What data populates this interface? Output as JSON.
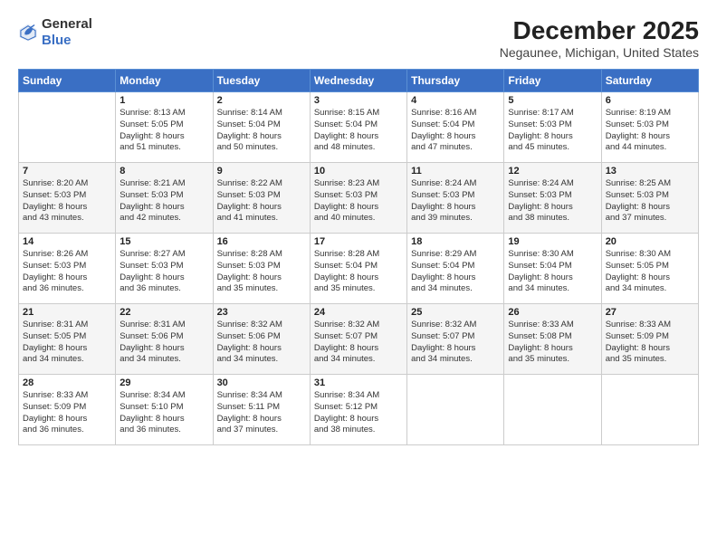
{
  "logo": {
    "general": "General",
    "blue": "Blue"
  },
  "title": "December 2025",
  "subtitle": "Negaunee, Michigan, United States",
  "days_header": [
    "Sunday",
    "Monday",
    "Tuesday",
    "Wednesday",
    "Thursday",
    "Friday",
    "Saturday"
  ],
  "weeks": [
    [
      {
        "day": "",
        "lines": []
      },
      {
        "day": "1",
        "lines": [
          "Sunrise: 8:13 AM",
          "Sunset: 5:05 PM",
          "Daylight: 8 hours",
          "and 51 minutes."
        ]
      },
      {
        "day": "2",
        "lines": [
          "Sunrise: 8:14 AM",
          "Sunset: 5:04 PM",
          "Daylight: 8 hours",
          "and 50 minutes."
        ]
      },
      {
        "day": "3",
        "lines": [
          "Sunrise: 8:15 AM",
          "Sunset: 5:04 PM",
          "Daylight: 8 hours",
          "and 48 minutes."
        ]
      },
      {
        "day": "4",
        "lines": [
          "Sunrise: 8:16 AM",
          "Sunset: 5:04 PM",
          "Daylight: 8 hours",
          "and 47 minutes."
        ]
      },
      {
        "day": "5",
        "lines": [
          "Sunrise: 8:17 AM",
          "Sunset: 5:03 PM",
          "Daylight: 8 hours",
          "and 45 minutes."
        ]
      },
      {
        "day": "6",
        "lines": [
          "Sunrise: 8:19 AM",
          "Sunset: 5:03 PM",
          "Daylight: 8 hours",
          "and 44 minutes."
        ]
      }
    ],
    [
      {
        "day": "7",
        "lines": [
          "Sunrise: 8:20 AM",
          "Sunset: 5:03 PM",
          "Daylight: 8 hours",
          "and 43 minutes."
        ]
      },
      {
        "day": "8",
        "lines": [
          "Sunrise: 8:21 AM",
          "Sunset: 5:03 PM",
          "Daylight: 8 hours",
          "and 42 minutes."
        ]
      },
      {
        "day": "9",
        "lines": [
          "Sunrise: 8:22 AM",
          "Sunset: 5:03 PM",
          "Daylight: 8 hours",
          "and 41 minutes."
        ]
      },
      {
        "day": "10",
        "lines": [
          "Sunrise: 8:23 AM",
          "Sunset: 5:03 PM",
          "Daylight: 8 hours",
          "and 40 minutes."
        ]
      },
      {
        "day": "11",
        "lines": [
          "Sunrise: 8:24 AM",
          "Sunset: 5:03 PM",
          "Daylight: 8 hours",
          "and 39 minutes."
        ]
      },
      {
        "day": "12",
        "lines": [
          "Sunrise: 8:24 AM",
          "Sunset: 5:03 PM",
          "Daylight: 8 hours",
          "and 38 minutes."
        ]
      },
      {
        "day": "13",
        "lines": [
          "Sunrise: 8:25 AM",
          "Sunset: 5:03 PM",
          "Daylight: 8 hours",
          "and 37 minutes."
        ]
      }
    ],
    [
      {
        "day": "14",
        "lines": [
          "Sunrise: 8:26 AM",
          "Sunset: 5:03 PM",
          "Daylight: 8 hours",
          "and 36 minutes."
        ]
      },
      {
        "day": "15",
        "lines": [
          "Sunrise: 8:27 AM",
          "Sunset: 5:03 PM",
          "Daylight: 8 hours",
          "and 36 minutes."
        ]
      },
      {
        "day": "16",
        "lines": [
          "Sunrise: 8:28 AM",
          "Sunset: 5:03 PM",
          "Daylight: 8 hours",
          "and 35 minutes."
        ]
      },
      {
        "day": "17",
        "lines": [
          "Sunrise: 8:28 AM",
          "Sunset: 5:04 PM",
          "Daylight: 8 hours",
          "and 35 minutes."
        ]
      },
      {
        "day": "18",
        "lines": [
          "Sunrise: 8:29 AM",
          "Sunset: 5:04 PM",
          "Daylight: 8 hours",
          "and 34 minutes."
        ]
      },
      {
        "day": "19",
        "lines": [
          "Sunrise: 8:30 AM",
          "Sunset: 5:04 PM",
          "Daylight: 8 hours",
          "and 34 minutes."
        ]
      },
      {
        "day": "20",
        "lines": [
          "Sunrise: 8:30 AM",
          "Sunset: 5:05 PM",
          "Daylight: 8 hours",
          "and 34 minutes."
        ]
      }
    ],
    [
      {
        "day": "21",
        "lines": [
          "Sunrise: 8:31 AM",
          "Sunset: 5:05 PM",
          "Daylight: 8 hours",
          "and 34 minutes."
        ]
      },
      {
        "day": "22",
        "lines": [
          "Sunrise: 8:31 AM",
          "Sunset: 5:06 PM",
          "Daylight: 8 hours",
          "and 34 minutes."
        ]
      },
      {
        "day": "23",
        "lines": [
          "Sunrise: 8:32 AM",
          "Sunset: 5:06 PM",
          "Daylight: 8 hours",
          "and 34 minutes."
        ]
      },
      {
        "day": "24",
        "lines": [
          "Sunrise: 8:32 AM",
          "Sunset: 5:07 PM",
          "Daylight: 8 hours",
          "and 34 minutes."
        ]
      },
      {
        "day": "25",
        "lines": [
          "Sunrise: 8:32 AM",
          "Sunset: 5:07 PM",
          "Daylight: 8 hours",
          "and 34 minutes."
        ]
      },
      {
        "day": "26",
        "lines": [
          "Sunrise: 8:33 AM",
          "Sunset: 5:08 PM",
          "Daylight: 8 hours",
          "and 35 minutes."
        ]
      },
      {
        "day": "27",
        "lines": [
          "Sunrise: 8:33 AM",
          "Sunset: 5:09 PM",
          "Daylight: 8 hours",
          "and 35 minutes."
        ]
      }
    ],
    [
      {
        "day": "28",
        "lines": [
          "Sunrise: 8:33 AM",
          "Sunset: 5:09 PM",
          "Daylight: 8 hours",
          "and 36 minutes."
        ]
      },
      {
        "day": "29",
        "lines": [
          "Sunrise: 8:34 AM",
          "Sunset: 5:10 PM",
          "Daylight: 8 hours",
          "and 36 minutes."
        ]
      },
      {
        "day": "30",
        "lines": [
          "Sunrise: 8:34 AM",
          "Sunset: 5:11 PM",
          "Daylight: 8 hours",
          "and 37 minutes."
        ]
      },
      {
        "day": "31",
        "lines": [
          "Sunrise: 8:34 AM",
          "Sunset: 5:12 PM",
          "Daylight: 8 hours",
          "and 38 minutes."
        ]
      },
      {
        "day": "",
        "lines": []
      },
      {
        "day": "",
        "lines": []
      },
      {
        "day": "",
        "lines": []
      }
    ]
  ],
  "colors": {
    "header_bg": "#3a6fc4",
    "header_text": "#ffffff",
    "odd_row": "#ffffff",
    "even_row": "#f5f5f5"
  }
}
